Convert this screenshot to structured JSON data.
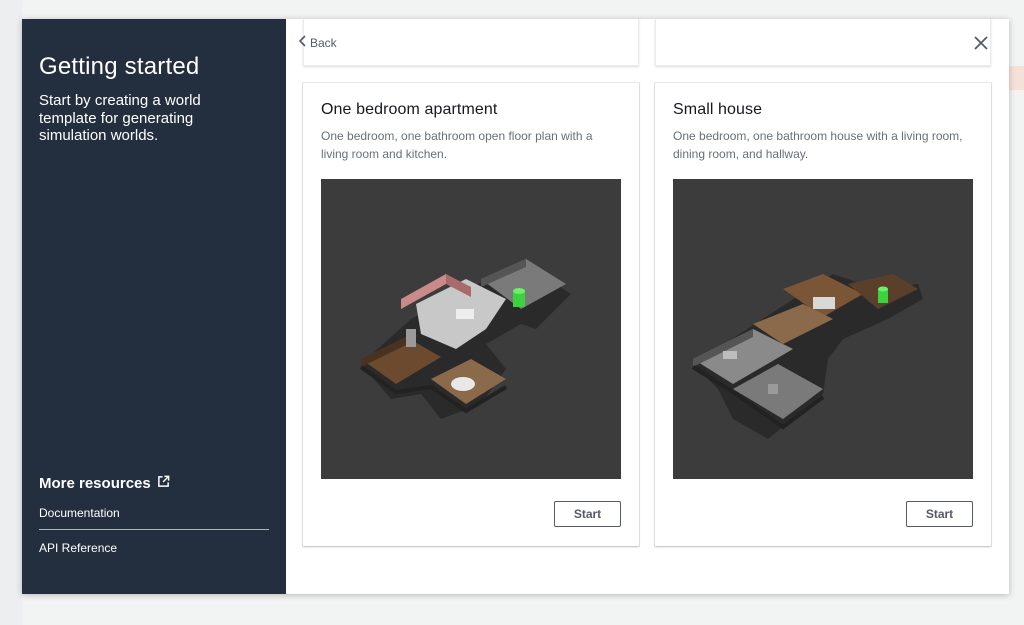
{
  "sidebar": {
    "title": "Getting started",
    "subtitle": "Start by creating a world template for generating simulation worlds.",
    "resources": {
      "title": "More resources",
      "links": [
        {
          "label": "Documentation"
        },
        {
          "label": "API Reference"
        }
      ]
    }
  },
  "nav": {
    "back_label": "Back"
  },
  "cards": [
    {
      "title": "One bedroom apartment",
      "description": "One bedroom, one bathroom open floor plan with a living room and kitchen.",
      "start_label": "Start"
    },
    {
      "title": "Small house",
      "description": "One bedroom, one bathroom house with a living room, dining room, and hallway.",
      "start_label": "Start"
    }
  ],
  "colors": {
    "sidebar_bg": "#232f3e",
    "preview_bg": "#3c3c3c",
    "button_border": "#545b64"
  },
  "icons": [
    "external-link-icon",
    "chevron-left-icon",
    "close-icon"
  ]
}
